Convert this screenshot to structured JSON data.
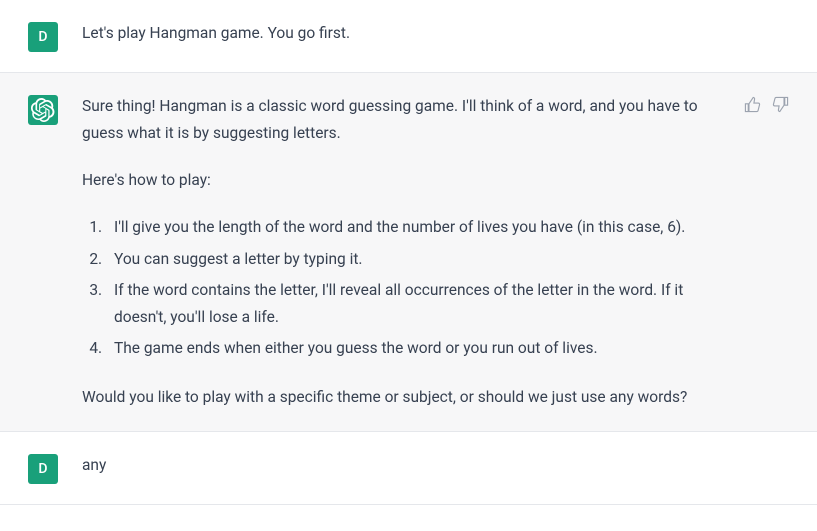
{
  "messages": [
    {
      "role": "user",
      "avatar_letter": "D",
      "text": "Let's play Hangman game. You go first."
    },
    {
      "role": "assistant",
      "intro": "Sure thing! Hangman is a classic word guessing game. I'll think of a word, and you have to guess what it is by suggesting letters.",
      "how_label": "Here's how to play:",
      "rules": [
        "I'll give you the length of the word and the number of lives you have (in this case, 6).",
        "You can suggest a letter by typing it.",
        "If the word contains the letter, I'll reveal all occurrences of the letter in the word. If it doesn't, you'll lose a life.",
        "The game ends when either you guess the word or you run out of lives."
      ],
      "outro": "Would you like to play with a specific theme or subject, or should we just use any words?"
    },
    {
      "role": "user",
      "avatar_letter": "D",
      "text": "any"
    }
  ]
}
